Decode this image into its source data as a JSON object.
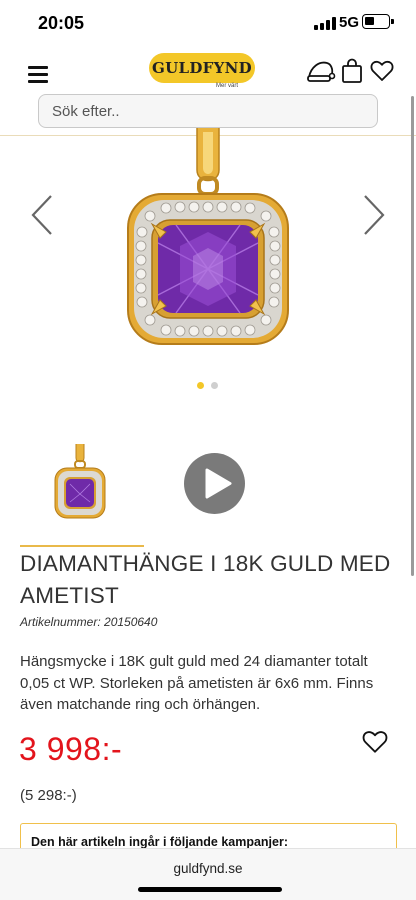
{
  "status": {
    "time": "20:05",
    "network": "5G"
  },
  "header": {
    "logo_text": "GULDFYND",
    "logo_tagline": "Mer värt",
    "search_placeholder": "Sök efter.."
  },
  "icons": {
    "menu": "hamburger-menu-icon",
    "christmas": "santa-hat-icon",
    "cart": "shopping-bag-icon",
    "wishlist": "heart-icon",
    "prev": "chevron-left-icon",
    "next": "chevron-right-icon",
    "video": "play-icon"
  },
  "carousel": {
    "active_index": 0,
    "count": 2
  },
  "product": {
    "title": "DIAMANTHÄNGE I 18K GULD MED AMETIST",
    "article_number": "Artikelnummer: 20150640",
    "description": "Hängsmycke i 18K gult guld med 24 diamanter totalt 0,05 ct WP. Storleken på ametisten är 6x6 mm. Finns även matchande ring och örhängen.",
    "price": "3 998:-",
    "original_price": "(5 298:-)"
  },
  "campaign": {
    "heading": "Den här artikeln ingår i följande kampanjer:"
  },
  "browser": {
    "url": "guldfynd.se"
  },
  "colors": {
    "brand_yellow": "#f3c728",
    "price_red": "#e3141c",
    "accent_gold": "#f0c04b",
    "amethyst": "#7b2fb5"
  }
}
